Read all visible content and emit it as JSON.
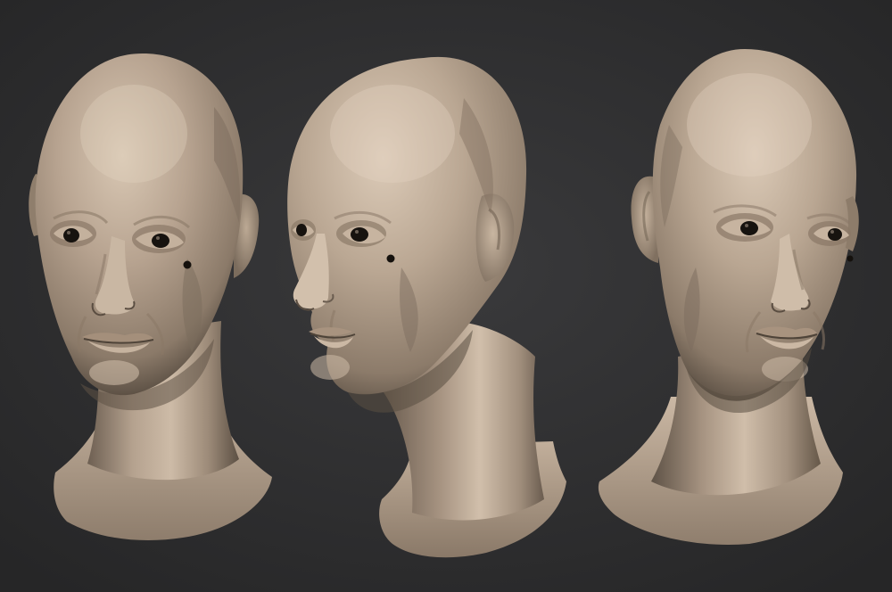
{
  "scene": {
    "background": "#2b2b2c",
    "background_highlight": "#3a3a3c",
    "views": [
      "front-left-three-quarter",
      "left-profile-three-quarter",
      "front-right-three-quarter"
    ]
  },
  "material": {
    "skin_base": "#a08f7e",
    "skin_light": "#d7c5b1",
    "skin_mid": "#b9a692",
    "skin_shadow": "#6f6153",
    "skin_dark": "#4e4338",
    "eye": "#17130f",
    "mole": "#15110d"
  }
}
